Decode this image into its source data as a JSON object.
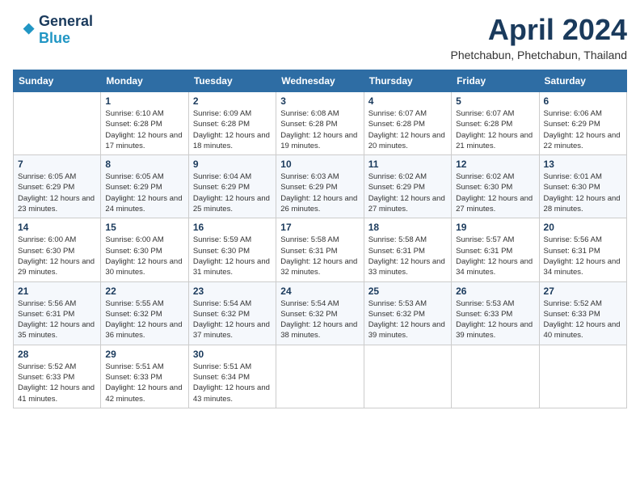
{
  "logo": {
    "line1": "General",
    "line2": "Blue"
  },
  "title": "April 2024",
  "location": "Phetchabun, Phetchabun, Thailand",
  "headers": [
    "Sunday",
    "Monday",
    "Tuesday",
    "Wednesday",
    "Thursday",
    "Friday",
    "Saturday"
  ],
  "weeks": [
    [
      {
        "day": "",
        "sunrise": "",
        "sunset": "",
        "daylight": ""
      },
      {
        "day": "1",
        "sunrise": "Sunrise: 6:10 AM",
        "sunset": "Sunset: 6:28 PM",
        "daylight": "Daylight: 12 hours and 17 minutes."
      },
      {
        "day": "2",
        "sunrise": "Sunrise: 6:09 AM",
        "sunset": "Sunset: 6:28 PM",
        "daylight": "Daylight: 12 hours and 18 minutes."
      },
      {
        "day": "3",
        "sunrise": "Sunrise: 6:08 AM",
        "sunset": "Sunset: 6:28 PM",
        "daylight": "Daylight: 12 hours and 19 minutes."
      },
      {
        "day": "4",
        "sunrise": "Sunrise: 6:07 AM",
        "sunset": "Sunset: 6:28 PM",
        "daylight": "Daylight: 12 hours and 20 minutes."
      },
      {
        "day": "5",
        "sunrise": "Sunrise: 6:07 AM",
        "sunset": "Sunset: 6:28 PM",
        "daylight": "Daylight: 12 hours and 21 minutes."
      },
      {
        "day": "6",
        "sunrise": "Sunrise: 6:06 AM",
        "sunset": "Sunset: 6:29 PM",
        "daylight": "Daylight: 12 hours and 22 minutes."
      }
    ],
    [
      {
        "day": "7",
        "sunrise": "Sunrise: 6:05 AM",
        "sunset": "Sunset: 6:29 PM",
        "daylight": "Daylight: 12 hours and 23 minutes."
      },
      {
        "day": "8",
        "sunrise": "Sunrise: 6:05 AM",
        "sunset": "Sunset: 6:29 PM",
        "daylight": "Daylight: 12 hours and 24 minutes."
      },
      {
        "day": "9",
        "sunrise": "Sunrise: 6:04 AM",
        "sunset": "Sunset: 6:29 PM",
        "daylight": "Daylight: 12 hours and 25 minutes."
      },
      {
        "day": "10",
        "sunrise": "Sunrise: 6:03 AM",
        "sunset": "Sunset: 6:29 PM",
        "daylight": "Daylight: 12 hours and 26 minutes."
      },
      {
        "day": "11",
        "sunrise": "Sunrise: 6:02 AM",
        "sunset": "Sunset: 6:29 PM",
        "daylight": "Daylight: 12 hours and 27 minutes."
      },
      {
        "day": "12",
        "sunrise": "Sunrise: 6:02 AM",
        "sunset": "Sunset: 6:30 PM",
        "daylight": "Daylight: 12 hours and 27 minutes."
      },
      {
        "day": "13",
        "sunrise": "Sunrise: 6:01 AM",
        "sunset": "Sunset: 6:30 PM",
        "daylight": "Daylight: 12 hours and 28 minutes."
      }
    ],
    [
      {
        "day": "14",
        "sunrise": "Sunrise: 6:00 AM",
        "sunset": "Sunset: 6:30 PM",
        "daylight": "Daylight: 12 hours and 29 minutes."
      },
      {
        "day": "15",
        "sunrise": "Sunrise: 6:00 AM",
        "sunset": "Sunset: 6:30 PM",
        "daylight": "Daylight: 12 hours and 30 minutes."
      },
      {
        "day": "16",
        "sunrise": "Sunrise: 5:59 AM",
        "sunset": "Sunset: 6:30 PM",
        "daylight": "Daylight: 12 hours and 31 minutes."
      },
      {
        "day": "17",
        "sunrise": "Sunrise: 5:58 AM",
        "sunset": "Sunset: 6:31 PM",
        "daylight": "Daylight: 12 hours and 32 minutes."
      },
      {
        "day": "18",
        "sunrise": "Sunrise: 5:58 AM",
        "sunset": "Sunset: 6:31 PM",
        "daylight": "Daylight: 12 hours and 33 minutes."
      },
      {
        "day": "19",
        "sunrise": "Sunrise: 5:57 AM",
        "sunset": "Sunset: 6:31 PM",
        "daylight": "Daylight: 12 hours and 34 minutes."
      },
      {
        "day": "20",
        "sunrise": "Sunrise: 5:56 AM",
        "sunset": "Sunset: 6:31 PM",
        "daylight": "Daylight: 12 hours and 34 minutes."
      }
    ],
    [
      {
        "day": "21",
        "sunrise": "Sunrise: 5:56 AM",
        "sunset": "Sunset: 6:31 PM",
        "daylight": "Daylight: 12 hours and 35 minutes."
      },
      {
        "day": "22",
        "sunrise": "Sunrise: 5:55 AM",
        "sunset": "Sunset: 6:32 PM",
        "daylight": "Daylight: 12 hours and 36 minutes."
      },
      {
        "day": "23",
        "sunrise": "Sunrise: 5:54 AM",
        "sunset": "Sunset: 6:32 PM",
        "daylight": "Daylight: 12 hours and 37 minutes."
      },
      {
        "day": "24",
        "sunrise": "Sunrise: 5:54 AM",
        "sunset": "Sunset: 6:32 PM",
        "daylight": "Daylight: 12 hours and 38 minutes."
      },
      {
        "day": "25",
        "sunrise": "Sunrise: 5:53 AM",
        "sunset": "Sunset: 6:32 PM",
        "daylight": "Daylight: 12 hours and 39 minutes."
      },
      {
        "day": "26",
        "sunrise": "Sunrise: 5:53 AM",
        "sunset": "Sunset: 6:33 PM",
        "daylight": "Daylight: 12 hours and 39 minutes."
      },
      {
        "day": "27",
        "sunrise": "Sunrise: 5:52 AM",
        "sunset": "Sunset: 6:33 PM",
        "daylight": "Daylight: 12 hours and 40 minutes."
      }
    ],
    [
      {
        "day": "28",
        "sunrise": "Sunrise: 5:52 AM",
        "sunset": "Sunset: 6:33 PM",
        "daylight": "Daylight: 12 hours and 41 minutes."
      },
      {
        "day": "29",
        "sunrise": "Sunrise: 5:51 AM",
        "sunset": "Sunset: 6:33 PM",
        "daylight": "Daylight: 12 hours and 42 minutes."
      },
      {
        "day": "30",
        "sunrise": "Sunrise: 5:51 AM",
        "sunset": "Sunset: 6:34 PM",
        "daylight": "Daylight: 12 hours and 43 minutes."
      },
      {
        "day": "",
        "sunrise": "",
        "sunset": "",
        "daylight": ""
      },
      {
        "day": "",
        "sunrise": "",
        "sunset": "",
        "daylight": ""
      },
      {
        "day": "",
        "sunrise": "",
        "sunset": "",
        "daylight": ""
      },
      {
        "day": "",
        "sunrise": "",
        "sunset": "",
        "daylight": ""
      }
    ]
  ]
}
